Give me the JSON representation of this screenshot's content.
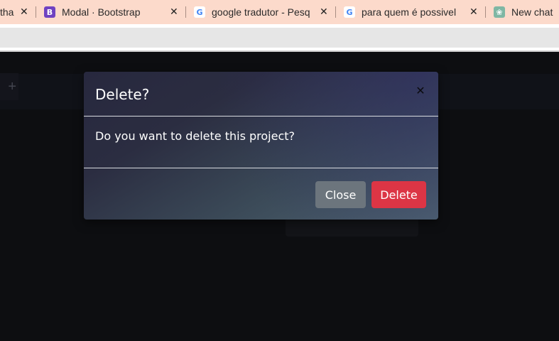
{
  "browser": {
    "tabs": [
      {
        "title": "tha",
        "favicon": "partial-tab-icon"
      },
      {
        "title": "Modal · Bootstrap",
        "favicon": "bootstrap-icon",
        "favicon_text": "B"
      },
      {
        "title": "google tradutor - Pesq",
        "favicon": "google-icon",
        "favicon_text": "G"
      },
      {
        "title": "para quem é possivel",
        "favicon": "google-icon",
        "favicon_text": "G"
      },
      {
        "title": "New chat",
        "favicon": "chatgpt-icon",
        "favicon_text": "❀"
      }
    ],
    "close_glyph": "✕"
  },
  "page": {
    "bg_fragment_text": "+"
  },
  "modal": {
    "title": "Delete?",
    "close_glyph": "✕",
    "body_text": "Do you want to delete this project?",
    "buttons": {
      "close_label": "Close",
      "delete_label": "Delete"
    }
  },
  "colors": {
    "tab_strip": "#fcdacb",
    "page_bg": "#121317",
    "close_button": "#6c757d",
    "delete_button": "#dc3545",
    "bootstrap_purple": "#6f42c1"
  }
}
